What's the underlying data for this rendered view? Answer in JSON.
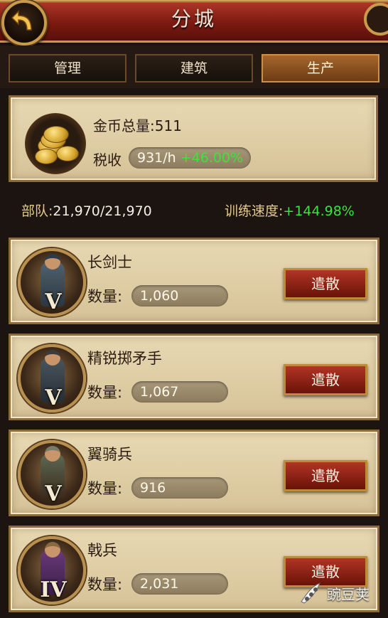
{
  "header": {
    "title": "分城"
  },
  "tabs": [
    {
      "label": "管理",
      "active": false
    },
    {
      "label": "建筑",
      "active": false
    },
    {
      "label": "生产",
      "active": true
    }
  ],
  "gold": {
    "total_label": "金币总量:",
    "total_value": "511",
    "tax_label": "税收",
    "tax_rate": "931/h",
    "tax_bonus": "+46.00%",
    "icon": "gold-coins-icon"
  },
  "stats": {
    "troops_label": "部队:",
    "troops_value": "21,970/21,970",
    "speed_label": "训练速度:",
    "speed_value": "+144.98%"
  },
  "units": [
    {
      "name": "长剑士",
      "qty_label": "数量:",
      "qty": "1,060",
      "rank": "V",
      "button": "遣散"
    },
    {
      "name": "精锐掷矛手",
      "qty_label": "数量:",
      "qty": "1,067",
      "rank": "V",
      "button": "遣散"
    },
    {
      "name": "翼骑兵",
      "qty_label": "数量:",
      "qty": "916",
      "rank": "V",
      "button": "遣散"
    },
    {
      "name": "戟兵",
      "qty_label": "数量:",
      "qty": "2,031",
      "rank": "IV",
      "button": "遣散"
    }
  ],
  "watermark": {
    "text": "豌豆荚"
  },
  "colors": {
    "header": "#7d1a12",
    "accent_gold": "#c99a4c",
    "positive": "#37e63a",
    "panel": "#e0cfa8"
  }
}
